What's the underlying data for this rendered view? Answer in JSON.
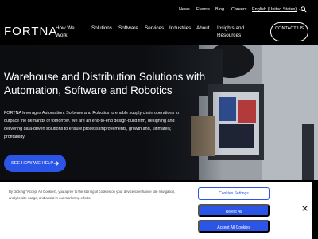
{
  "utility_nav": {
    "news": "News",
    "events": "Events",
    "blog": "Blog",
    "careers": "Careers",
    "language": "English (United States)",
    "search_icon": "search-icon"
  },
  "header": {
    "logo": "FORTNA",
    "nav": {
      "how_we_work": "How We Work",
      "solutions": "Solutions",
      "software": "Software",
      "services": "Services",
      "industries": "Industries",
      "about": "About",
      "insights": "Insights and Resources"
    },
    "contact": "CONTACT US"
  },
  "hero": {
    "headline": "Warehouse and Distribution Solutions with Automation, Software and Robotics",
    "body": "FORTNA leverages Automation, Software and Robotics to enable supply chain operations to outpace the demands of tomorrow. We are an end-to-end design-build firm, designing and delivering data-driven solutions to ensure process improvements, growth and, ultimately, profitability.",
    "cta": "SEE HOW WE HELP"
  },
  "cookie_banner": {
    "text": "By clicking “Accept All Cookies”, you agree to the storing of cookies on your device to enhance site navigation, analyze site usage, and assist in our marketing efforts.",
    "settings": "Cookies Settings",
    "reject": "Reject All",
    "accept": "Accept All Cookies"
  },
  "colors": {
    "accent": "#2b55e6",
    "background": "#000000",
    "banner": "#ffffff"
  }
}
